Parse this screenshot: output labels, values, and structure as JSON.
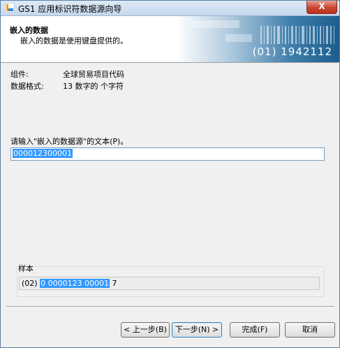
{
  "window": {
    "title": "GS1 应用标识符数据源向导",
    "close_label": "X"
  },
  "header": {
    "title": "嵌入的数据",
    "subtitle": "嵌入的数据是使用键盘提供的。",
    "banner_text": "(01) 1942112"
  },
  "info": {
    "component_label": "组件:",
    "component_value": "全球贸易项目代码",
    "format_label": "数据格式:",
    "format_value": "13 数字的 个字符"
  },
  "prompt": {
    "label": "请输入\"嵌入的数据源\"的文本(P)。",
    "value": "000012300001"
  },
  "sample": {
    "group_label": "样本",
    "prefix": "(02) ",
    "selected": "0 0000123 00001",
    "suffix": " 7"
  },
  "buttons": {
    "back": "< 上一步(B)",
    "next": "下一步(N) >",
    "finish": "完成(F)",
    "cancel": "取消"
  },
  "colors": {
    "selection": "#3399ff",
    "close_red": "#c94530",
    "banner_blue": "#1b5e8e"
  }
}
